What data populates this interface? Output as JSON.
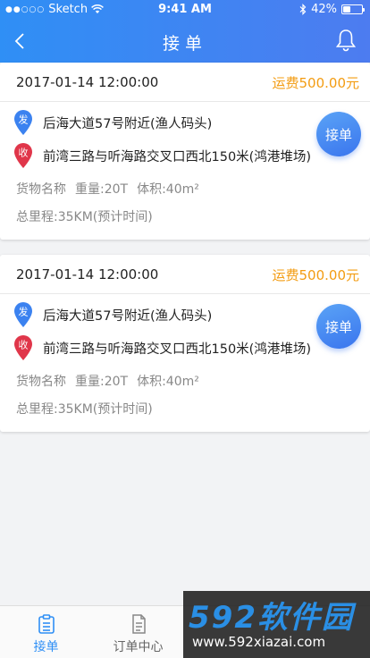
{
  "status_bar": {
    "carrier": "Sketch",
    "time": "9:41 AM",
    "battery": "42%",
    "battery_level": 0.42
  },
  "header": {
    "title": "接单"
  },
  "orders": [
    {
      "time": "2017-01-14 12:00:00",
      "fee": "运费500.00元",
      "from_badge": "发",
      "from": "后海大道57号附近(渔人码头)",
      "to_badge": "收",
      "to": "前湾三路与听海路交叉口西北150米(鸿港堆场)",
      "cargo": "货物名称",
      "weight": "重量:20T",
      "volume": "体积:40m²",
      "distance": "总里程:35KM(预计时间)",
      "accept_label": "接单"
    },
    {
      "time": "2017-01-14 12:00:00",
      "fee": "运费500.00元",
      "from_badge": "发",
      "from": "后海大道57号附近(渔人码头)",
      "to_badge": "收",
      "to": "前湾三路与听海路交叉口西北150米(鸿港堆场)",
      "cargo": "货物名称",
      "weight": "重量:20T",
      "volume": "体积:40m²",
      "distance": "总里程:35KM(预计时间)",
      "accept_label": "接单"
    }
  ],
  "tabbar": {
    "tabs": [
      {
        "label": "接单",
        "icon": "clipboard-icon"
      },
      {
        "label": "订单中心",
        "icon": "document-icon"
      }
    ]
  },
  "watermark": {
    "brand": "592软件园",
    "url": "www.592xiazai.com"
  },
  "colors": {
    "primary": "#2f8ff5",
    "fee": "#f39c12",
    "from_pin": "#3b82f0",
    "to_pin": "#e0364a"
  }
}
